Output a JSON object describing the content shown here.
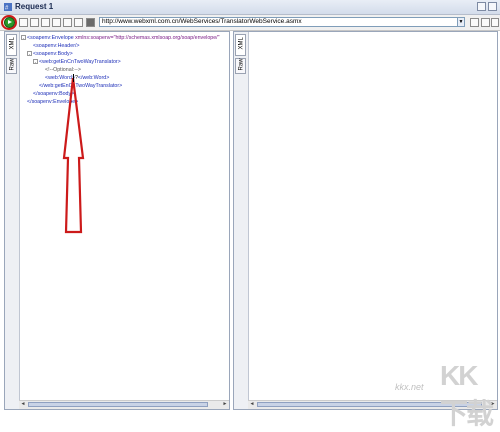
{
  "window": {
    "title": "Request 1"
  },
  "toolbar": {
    "url": "http://www.webxml.com.cn/WebServices/TranslatorWebService.asmx"
  },
  "left_pane": {
    "tabs": [
      "XML",
      "Raw"
    ],
    "lines": [
      {
        "indent": 0,
        "fold": "-",
        "parts": [
          [
            "tag",
            "<soapenv:Envelope "
          ],
          [
            "attr",
            "xmlns:soapenv=\"http://schemas.xmlsoap.org/soap/envelope/\""
          ]
        ]
      },
      {
        "indent": 1,
        "fold": "",
        "parts": [
          [
            "tag",
            "<soapenv:Header/>"
          ]
        ]
      },
      {
        "indent": 1,
        "fold": "-",
        "parts": [
          [
            "tag",
            "<soapenv:Body>"
          ]
        ]
      },
      {
        "indent": 2,
        "fold": "-",
        "parts": [
          [
            "tag",
            "<web:getEnCnTwoWayTranslator>"
          ]
        ]
      },
      {
        "indent": 3,
        "fold": "",
        "parts": [
          [
            "comment",
            "<!--Optional:-->"
          ]
        ]
      },
      {
        "indent": 3,
        "fold": "",
        "parts": [
          [
            "tag",
            "<web:Word>"
          ],
          [
            "plain",
            "?"
          ],
          [
            "tag",
            "</web:Word>"
          ]
        ]
      },
      {
        "indent": 2,
        "fold": "",
        "parts": [
          [
            "tag",
            "</web:getEnCnTwoWayTranslator>"
          ]
        ]
      },
      {
        "indent": 1,
        "fold": "",
        "parts": [
          [
            "tag",
            "</soapenv:Body>"
          ]
        ]
      },
      {
        "indent": 0,
        "fold": "",
        "parts": [
          [
            "tag",
            "</soapenv:Envelope>"
          ]
        ]
      }
    ]
  },
  "right_pane": {
    "tabs": [
      "XML",
      "Raw"
    ]
  },
  "watermark": {
    "cn": "KK下载",
    "en": "kkx.net"
  },
  "colors": {
    "tag": "#1e2fb8",
    "attr": "#7a1b86",
    "annotation": "#cc1a1a"
  }
}
